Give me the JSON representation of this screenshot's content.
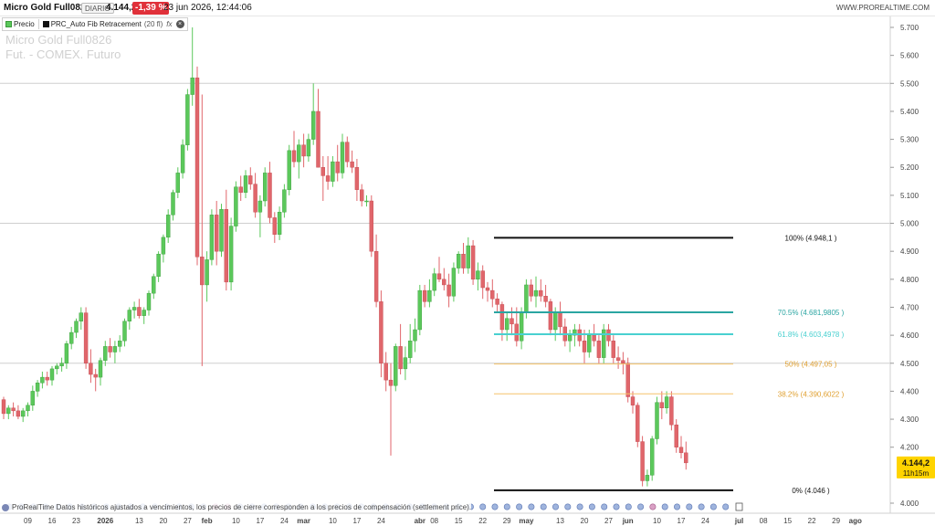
{
  "header": {
    "title": "Micro Gold Full0826",
    "period": "DIARIO",
    "price": "4.144,2",
    "change": "-1,39 %",
    "datetime": "23 jun 2026, 12:44:06",
    "site": "WWW.PROREALTIME.COM"
  },
  "legend": {
    "price_label": "Precio",
    "indicator_label": "PRC_Auto Fib Retracement",
    "indicator_param": "(20 fl)",
    "fx_label": "fx"
  },
  "watermark": {
    "line1": "Micro Gold Full0826",
    "line2": "Fut. - COMEX. Futuro"
  },
  "footnote": "ProRealTime Datos históricos ajustados a vencimientos, los precios de cierre corresponden a los precios de compensación (settlement price).",
  "last_price_badge": {
    "price": "4.144,2",
    "countdown": "11h15m"
  },
  "colors": {
    "up": "#5bc85b",
    "down": "#e0666b",
    "fib_extreme": "#111111",
    "fib_teal": "#2aa5a2",
    "fib_cyan": "#49d0d0",
    "fib_orange": "#f5c36a",
    "badge": "#ffd400"
  },
  "chart_data": {
    "type": "candlestick",
    "ylim": [
      4000,
      5750
    ],
    "y_ticks": [
      "5.700",
      "5.600",
      "5.500",
      "5.400",
      "5.300",
      "5.200",
      "5.100",
      "5.000",
      "4.900",
      "4.800",
      "4.700",
      "4.600",
      "4.500",
      "4.400",
      "4.300",
      "4.200",
      "4.000"
    ],
    "y_tick_values": [
      5700,
      5600,
      5500,
      5400,
      5300,
      5200,
      5100,
      5000,
      4900,
      4800,
      4700,
      4600,
      4500,
      4400,
      4300,
      4200,
      4000
    ],
    "x_labels": [
      {
        "label": "09",
        "i": 5
      },
      {
        "label": "16",
        "i": 10
      },
      {
        "label": "23",
        "i": 15
      },
      {
        "label": "2026",
        "i": 21,
        "bold": true
      },
      {
        "label": "13",
        "i": 28
      },
      {
        "label": "20",
        "i": 33
      },
      {
        "label": "27",
        "i": 38
      },
      {
        "label": "feb",
        "i": 42,
        "bold": true
      },
      {
        "label": "10",
        "i": 48
      },
      {
        "label": "17",
        "i": 53
      },
      {
        "label": "24",
        "i": 58
      },
      {
        "label": "mar",
        "i": 62,
        "bold": true
      },
      {
        "label": "10",
        "i": 68
      },
      {
        "label": "17",
        "i": 73
      },
      {
        "label": "24",
        "i": 78
      },
      {
        "label": "abr",
        "i": 86,
        "bold": true
      },
      {
        "label": "08",
        "i": 89
      },
      {
        "label": "15",
        "i": 94
      },
      {
        "label": "22",
        "i": 99
      },
      {
        "label": "29",
        "i": 104
      },
      {
        "label": "may",
        "i": 108,
        "bold": true
      },
      {
        "label": "13",
        "i": 115
      },
      {
        "label": "20",
        "i": 120
      },
      {
        "label": "27",
        "i": 125
      },
      {
        "label": "jun",
        "i": 129,
        "bold": true
      },
      {
        "label": "10",
        "i": 135
      },
      {
        "label": "17",
        "i": 140
      },
      {
        "label": "24",
        "i": 145
      },
      {
        "label": "jul",
        "i": 152,
        "bold": true
      },
      {
        "label": "08",
        "i": 157
      },
      {
        "label": "15",
        "i": 162
      },
      {
        "label": "22",
        "i": 167
      },
      {
        "label": "29",
        "i": 172
      },
      {
        "label": "ago",
        "i": 176,
        "bold": true
      }
    ],
    "candles": [
      [
        4370,
        4380,
        4300,
        4320
      ],
      [
        4320,
        4350,
        4300,
        4340
      ],
      [
        4340,
        4360,
        4310,
        4330
      ],
      [
        4330,
        4350,
        4300,
        4310
      ],
      [
        4310,
        4340,
        4290,
        4330
      ],
      [
        4330,
        4360,
        4310,
        4350
      ],
      [
        4350,
        4420,
        4330,
        4400
      ],
      [
        4400,
        4440,
        4380,
        4430
      ],
      [
        4430,
        4470,
        4410,
        4450
      ],
      [
        4450,
        4470,
        4420,
        4440
      ],
      [
        4440,
        4490,
        4420,
        4480
      ],
      [
        4480,
        4500,
        4460,
        4490
      ],
      [
        4490,
        4520,
        4470,
        4500
      ],
      [
        4500,
        4580,
        4480,
        4570
      ],
      [
        4570,
        4630,
        4550,
        4610
      ],
      [
        4610,
        4660,
        4590,
        4650
      ],
      [
        4650,
        4700,
        4620,
        4680
      ],
      [
        4680,
        4700,
        4480,
        4500
      ],
      [
        4500,
        4550,
        4430,
        4460
      ],
      [
        4460,
        4480,
        4400,
        4450
      ],
      [
        4450,
        4520,
        4420,
        4510
      ],
      [
        4510,
        4580,
        4490,
        4560
      ],
      [
        4560,
        4590,
        4520,
        4540
      ],
      [
        4540,
        4580,
        4500,
        4560
      ],
      [
        4560,
        4600,
        4540,
        4580
      ],
      [
        4580,
        4660,
        4560,
        4650
      ],
      [
        4650,
        4700,
        4620,
        4690
      ],
      [
        4690,
        4720,
        4660,
        4700
      ],
      [
        4700,
        4730,
        4660,
        4670
      ],
      [
        4670,
        4700,
        4640,
        4690
      ],
      [
        4690,
        4760,
        4670,
        4750
      ],
      [
        4750,
        4820,
        4730,
        4810
      ],
      [
        4810,
        4900,
        4790,
        4890
      ],
      [
        4890,
        4960,
        4860,
        4950
      ],
      [
        4950,
        5050,
        4930,
        5030
      ],
      [
        5030,
        5120,
        5010,
        5110
      ],
      [
        5110,
        5200,
        5090,
        5180
      ],
      [
        5180,
        5300,
        5160,
        5280
      ],
      [
        5280,
        5480,
        5260,
        5460
      ],
      [
        5460,
        5700,
        5420,
        5520
      ],
      [
        5520,
        5560,
        4850,
        4880
      ],
      [
        4880,
        5460,
        4490,
        4780
      ],
      [
        4780,
        4900,
        4720,
        4870
      ],
      [
        4870,
        5050,
        4850,
        5030
      ],
      [
        5030,
        5080,
        4850,
        4900
      ],
      [
        4900,
        5070,
        4880,
        5050
      ],
      [
        5050,
        5120,
        4760,
        4790
      ],
      [
        4790,
        5020,
        4760,
        4990
      ],
      [
        4990,
        5150,
        4970,
        5130
      ],
      [
        5130,
        5170,
        5080,
        5110
      ],
      [
        5110,
        5190,
        5090,
        5170
      ],
      [
        5170,
        5200,
        5120,
        5140
      ],
      [
        5140,
        5180,
        5020,
        5040
      ],
      [
        5040,
        5100,
        4950,
        5080
      ],
      [
        5080,
        5200,
        5060,
        5180
      ],
      [
        5180,
        5220,
        5000,
        5020
      ],
      [
        5020,
        5040,
        4930,
        4960
      ],
      [
        4960,
        5060,
        4940,
        5040
      ],
      [
        5040,
        5140,
        5020,
        5120
      ],
      [
        5120,
        5280,
        5100,
        5260
      ],
      [
        5260,
        5330,
        5200,
        5220
      ],
      [
        5220,
        5300,
        5160,
        5280
      ],
      [
        5280,
        5320,
        5200,
        5240
      ],
      [
        5240,
        5320,
        5220,
        5300
      ],
      [
        5300,
        5500,
        5280,
        5400
      ],
      [
        5400,
        5480,
        5300,
        5200
      ],
      [
        5200,
        5240,
        5080,
        5170
      ],
      [
        5170,
        5240,
        5120,
        5150
      ],
      [
        5150,
        5240,
        5130,
        5220
      ],
      [
        5220,
        5280,
        5150,
        5180
      ],
      [
        5180,
        5320,
        5160,
        5290
      ],
      [
        5290,
        5310,
        5200,
        5220
      ],
      [
        5220,
        5260,
        5180,
        5200
      ],
      [
        5200,
        5230,
        5080,
        5120
      ],
      [
        5120,
        5140,
        5060,
        5080
      ],
      [
        5080,
        5100,
        5060,
        5080
      ],
      [
        5080,
        5100,
        4880,
        4900
      ],
      [
        4900,
        4960,
        4700,
        4720
      ],
      [
        4720,
        4760,
        4450,
        4500
      ],
      [
        4500,
        4540,
        4400,
        4440
      ],
      [
        4440,
        4500,
        4170,
        4420
      ],
      [
        4420,
        4570,
        4400,
        4560
      ],
      [
        4560,
        4640,
        4460,
        4480
      ],
      [
        4480,
        4560,
        4440,
        4520
      ],
      [
        4520,
        4640,
        4500,
        4580
      ],
      [
        4580,
        4660,
        4540,
        4620
      ],
      [
        4620,
        4780,
        4600,
        4760
      ],
      [
        4760,
        4780,
        4700,
        4720
      ],
      [
        4720,
        4800,
        4700,
        4760
      ],
      [
        4760,
        4840,
        4740,
        4820
      ],
      [
        4820,
        4880,
        4790,
        4800
      ],
      [
        4800,
        4840,
        4760,
        4780
      ],
      [
        4780,
        4820,
        4700,
        4740
      ],
      [
        4740,
        4860,
        4720,
        4840
      ],
      [
        4840,
        4900,
        4820,
        4890
      ],
      [
        4890,
        4930,
        4820,
        4840
      ],
      [
        4840,
        4950,
        4820,
        4920
      ],
      [
        4920,
        4940,
        4780,
        4800
      ],
      [
        4800,
        4860,
        4760,
        4830
      ],
      [
        4830,
        4850,
        4730,
        4770
      ],
      [
        4770,
        4790,
        4720,
        4760
      ],
      [
        4760,
        4800,
        4700,
        4730
      ],
      [
        4730,
        4750,
        4680,
        4710
      ],
      [
        4710,
        4720,
        4580,
        4620
      ],
      [
        4620,
        4680,
        4580,
        4660
      ],
      [
        4660,
        4700,
        4600,
        4640
      ],
      [
        4640,
        4700,
        4560,
        4580
      ],
      [
        4580,
        4700,
        4550,
        4680
      ],
      [
        4680,
        4800,
        4660,
        4780
      ],
      [
        4780,
        4800,
        4720,
        4740
      ],
      [
        4740,
        4810,
        4700,
        4760
      ],
      [
        4760,
        4800,
        4720,
        4740
      ],
      [
        4740,
        4780,
        4700,
        4720
      ],
      [
        4720,
        4730,
        4600,
        4620
      ],
      [
        4620,
        4700,
        4580,
        4680
      ],
      [
        4680,
        4720,
        4600,
        4630
      ],
      [
        4630,
        4660,
        4560,
        4580
      ],
      [
        4580,
        4620,
        4540,
        4600
      ],
      [
        4600,
        4640,
        4560,
        4620
      ],
      [
        4620,
        4640,
        4560,
        4580
      ],
      [
        4580,
        4620,
        4500,
        4540
      ],
      [
        4540,
        4620,
        4520,
        4600
      ],
      [
        4600,
        4640,
        4560,
        4580
      ],
      [
        4580,
        4600,
        4500,
        4520
      ],
      [
        4520,
        4640,
        4500,
        4620
      ],
      [
        4620,
        4640,
        4560,
        4580
      ],
      [
        4580,
        4600,
        4500,
        4520
      ],
      [
        4520,
        4560,
        4480,
        4510
      ],
      [
        4510,
        4540,
        4460,
        4500
      ],
      [
        4500,
        4520,
        4360,
        4380
      ],
      [
        4380,
        4400,
        4320,
        4350
      ],
      [
        4350,
        4360,
        4200,
        4220
      ],
      [
        4220,
        4240,
        4060,
        4080
      ],
      [
        4080,
        4120,
        4060,
        4100
      ],
      [
        4100,
        4240,
        4080,
        4230
      ],
      [
        4230,
        4380,
        4210,
        4360
      ],
      [
        4360,
        4400,
        4300,
        4340
      ],
      [
        4340,
        4400,
        4320,
        4380
      ],
      [
        4380,
        4400,
        4260,
        4280
      ],
      [
        4280,
        4300,
        4180,
        4200
      ],
      [
        4200,
        4240,
        4160,
        4180
      ],
      [
        4180,
        4220,
        4120,
        4144
      ]
    ],
    "fib_levels": [
      {
        "label": "100% (4.948,1 )",
        "value": 4948.1,
        "color": "#111111",
        "width": 2
      },
      {
        "label": "70.5% (4.681,9805 )",
        "value": 4681.98,
        "color": "#2aa5a2",
        "width": 2
      },
      {
        "label": "61.8% (4.603,4978 )",
        "value": 4603.5,
        "color": "#49d0d0",
        "width": 2
      },
      {
        "label": "50% (4.497,05 )",
        "value": 4497.05,
        "color": "#f5c36a",
        "width": 1
      },
      {
        "label": "38.2% (4.390,6022 )",
        "value": 4390.6,
        "color": "#f5c36a",
        "width": 1
      },
      {
        "label": "0% (4.046 )",
        "value": 4046,
        "color": "#111111",
        "width": 2
      }
    ],
    "fib_start_index": 98,
    "fib_end_index": 146,
    "major_lines": [
      5500,
      5000,
      4500
    ]
  }
}
